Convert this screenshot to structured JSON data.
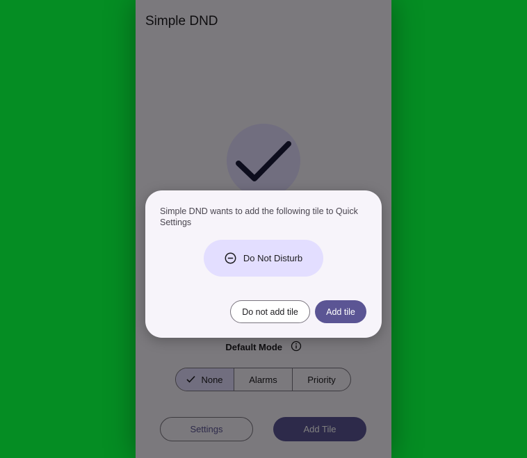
{
  "app": {
    "title": "Simple DND"
  },
  "main": {
    "default_mode_label": "Default Mode",
    "mode_options": [
      "None",
      "Alarms",
      "Priority"
    ],
    "selected_mode": "None",
    "settings_label": "Settings",
    "add_tile_label": "Add Tile"
  },
  "dialog": {
    "message": "Simple DND wants to add the following tile to Quick Settings",
    "tile_label": "Do Not Disturb",
    "cancel_label": "Do not add tile",
    "confirm_label": "Add tile"
  },
  "icons": {
    "status": "check-icon",
    "info": "info-icon",
    "tile": "dnd-icon"
  },
  "colors": {
    "background": "#058d23",
    "accent": "#5b5594",
    "tile": "#e3deff"
  }
}
